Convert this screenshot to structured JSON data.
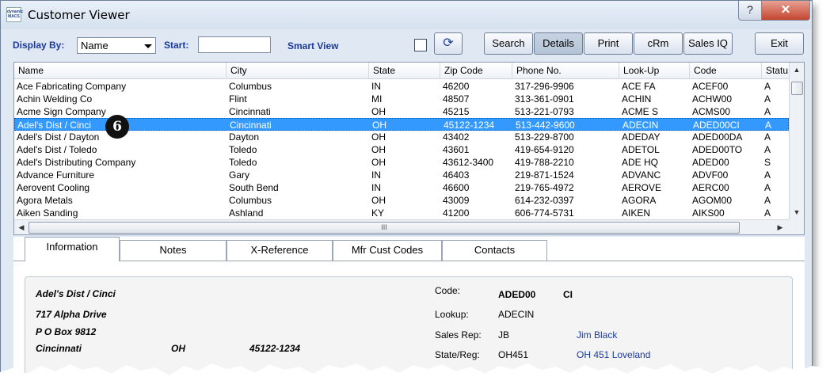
{
  "window": {
    "title": "Customer Viewer",
    "logo_text": "dynamic MACS",
    "help_label": "?",
    "close_label": "✕"
  },
  "toolbar": {
    "display_by_label": "Display By:",
    "display_by_value": "Name",
    "start_label": "Start:",
    "start_value": "",
    "smart_view_label": "Smart View",
    "refresh_icon": "⟳",
    "buttons": {
      "search": "Search",
      "details": "Details",
      "print": "Print",
      "crm": "cRm",
      "sales_iq": "Sales IQ",
      "exit": "Exit"
    }
  },
  "grid": {
    "columns": [
      "Name",
      "City",
      "State",
      "Zip Code",
      "Phone No.",
      "Look-Up",
      "Code",
      "Statu"
    ],
    "rows": [
      [
        "Ace Fabricating Company",
        "Columbus",
        "IN",
        "46200",
        "317-296-9906",
        "ACE FA",
        "ACEF00",
        "A"
      ],
      [
        "Achin Welding Co",
        "Flint",
        "MI",
        "48507",
        "313-361-0901",
        "ACHIN",
        "ACHW00",
        "A"
      ],
      [
        "Acme Sign Company",
        "Cincinnati",
        "OH",
        "45215",
        "513-221-0793",
        "ACME S",
        "ACMS00",
        "A"
      ],
      [
        "Adel's Dist / Cinci",
        "Cincinnati",
        "OH",
        "45122-1234",
        "513-442-9600",
        "ADECIN",
        "ADED00CI",
        "A"
      ],
      [
        "Adel's Dist / Dayton",
        "Dayton",
        "OH",
        "43402",
        "513-229-8700",
        "ADEDAY",
        "ADED00DA",
        "A"
      ],
      [
        "Adel's Dist / Toledo",
        "Toledo",
        "OH",
        "43601",
        "419-654-9120",
        "ADETOL",
        "ADED00TO",
        "A"
      ],
      [
        "Adel's Distributing Company",
        "Toledo",
        "OH",
        "43612-3400",
        "419-788-2210",
        "ADE HQ",
        "ADED00",
        "S"
      ],
      [
        "Advance Furniture",
        "Gary",
        "IN",
        "46403",
        "219-871-1524",
        "ADVANC",
        "ADVF00",
        "A"
      ],
      [
        "Aerovent Cooling",
        "South Bend",
        "IN",
        "46600",
        "219-765-4972",
        "AEROVE",
        "AERC00",
        "A"
      ],
      [
        "Agora Metals",
        "Columbus",
        "OH",
        "43009",
        "614-232-0397",
        "AGORA",
        "AGOM00",
        "A"
      ],
      [
        "Aiken Sanding",
        "Ashland",
        "KY",
        "41200",
        "606-774-5731",
        "AIKEN",
        "AIKS00",
        "A"
      ]
    ],
    "selected_row": 3,
    "callout_number": "6",
    "hscroll_grip": "III"
  },
  "tabs": [
    "Information",
    "Notes",
    "X-Reference",
    "Mfr Cust Codes",
    "Contacts"
  ],
  "info": {
    "name": "Adel's Dist / Cinci",
    "address1": "717 Alpha Drive",
    "address2": "P O Box 9812",
    "city": "Cincinnati",
    "state": "OH",
    "zip": "45122-1234",
    "code_label": "Code:",
    "code_value": "ADED00",
    "code_suffix": "CI",
    "lookup_label": "Lookup:",
    "lookup_value": "ADECIN",
    "sales_rep_label": "Sales Rep:",
    "sales_rep_code": "JB",
    "sales_rep_name": "Jim Black",
    "state_reg_label": "State/Reg:",
    "state_reg_code": "OH451",
    "state_reg_name": "OH 451 Loveland"
  }
}
